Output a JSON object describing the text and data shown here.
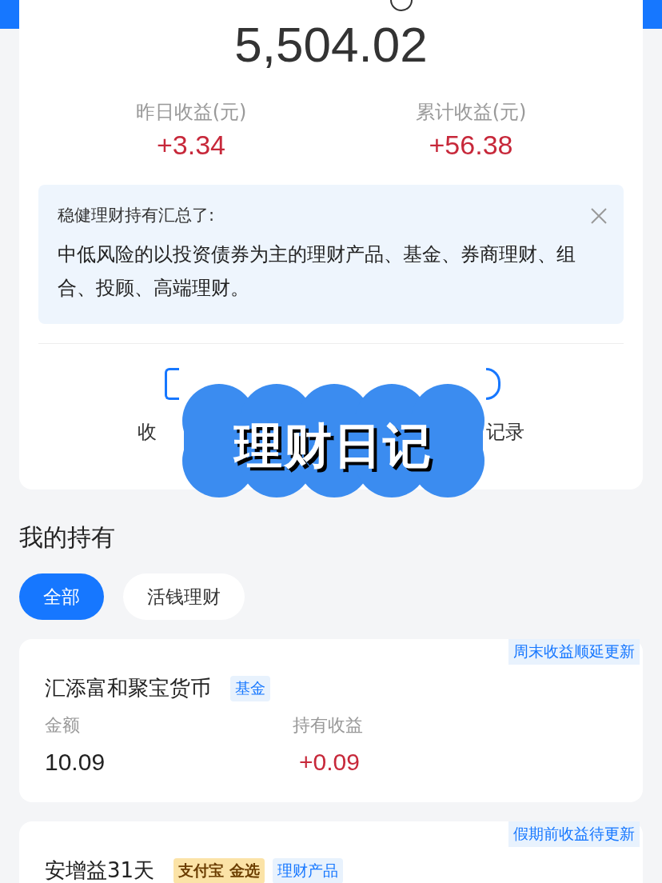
{
  "summary": {
    "total": "5,504.02",
    "stats": [
      {
        "label": "昨日收益(元)",
        "value": "+3.34"
      },
      {
        "label": "累计收益(元)",
        "value": "+56.38"
      }
    ]
  },
  "notice": {
    "title": "稳健理财持有汇总了:",
    "body": "中低风险的以投资债券为主的理财产品、基金、券商理财、组合、投顾、高端理财。"
  },
  "actions": [
    {
      "label": "收"
    },
    {
      "label": "记录"
    }
  ],
  "sticker": {
    "text": "理财日记"
  },
  "holdings": {
    "title": "我的持有",
    "tabs": [
      {
        "label": "全部",
        "selected": true
      },
      {
        "label": "活钱理财",
        "selected": false
      }
    ],
    "items": [
      {
        "notice": "周末收益顺延更新",
        "name": "汇添富和聚宝货币",
        "tags": [
          {
            "kind": "type",
            "text": "基金"
          }
        ],
        "amount_label": "金额",
        "amount": "10.09",
        "profit_label": "持有收益",
        "profit": "+0.09"
      },
      {
        "notice": "假期前收益待更新",
        "name": "安增益31天",
        "tags": [
          {
            "kind": "brand",
            "text": "支付宝 金选"
          },
          {
            "kind": "type",
            "text": "理财产品"
          }
        ]
      }
    ]
  }
}
